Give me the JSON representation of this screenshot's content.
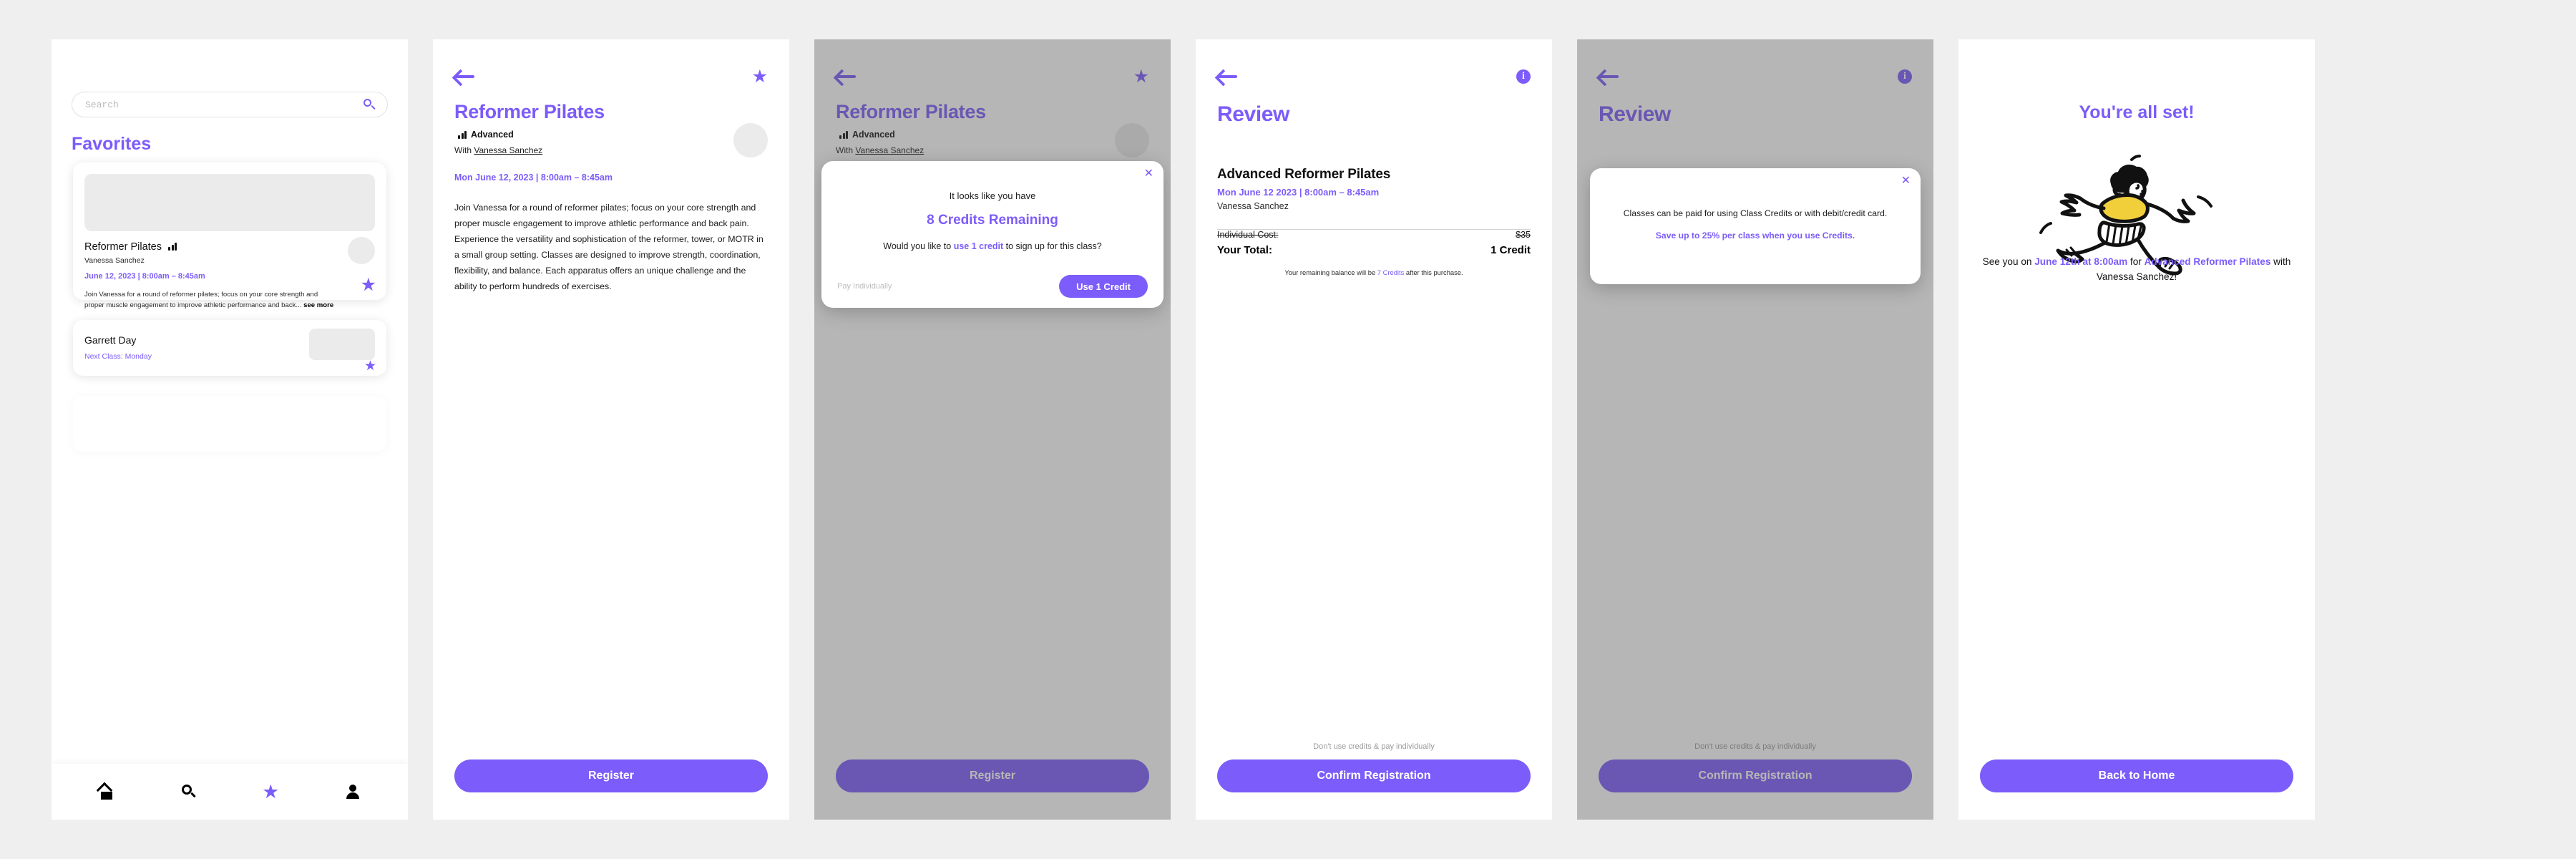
{
  "theme": {
    "accent": "#7c5cfa",
    "page_bg": "#efefef",
    "screen_bg": "#ffffff",
    "placeholder_gray": "#ebebeb"
  },
  "screens": [
    {
      "name": "favorites",
      "search": {
        "value": "",
        "placeholder": "Search",
        "icon": "search-icon"
      },
      "heading": "Favorites",
      "cards": [
        {
          "title": "Reformer Pilates",
          "level_icon": "difficulty-bars-icon",
          "instructor": "Vanessa Sanchez",
          "when": "June 12, 2023 | 8:00am – 8:45am",
          "description": "Join Vanessa for a round of reformer pilates; focus on your core strength and proper muscle engagement to improve athletic performance and back...",
          "see_more": "see more",
          "favorited": true
        },
        {
          "title": "Garrett Day",
          "next_class": "Next Class: Monday",
          "favorited": true
        }
      ],
      "tabs": [
        {
          "name": "home",
          "icon": "home-icon",
          "active": false
        },
        {
          "name": "search",
          "icon": "search-icon",
          "active": false
        },
        {
          "name": "favorites",
          "icon": "star-icon",
          "active": true
        },
        {
          "name": "profile",
          "icon": "person-icon",
          "active": false
        }
      ]
    },
    {
      "name": "class-detail",
      "back_icon": "back-arrow-icon",
      "favorite_icon": "star-icon",
      "title": "Reformer Pilates",
      "level": "Advanced",
      "level_icon": "difficulty-bars-icon",
      "with_prefix": "With ",
      "instructor": "Vanessa Sanchez",
      "when": "Mon June 12, 2023 | 8:00am – 8:45am",
      "body": "Join Vanessa for a round of reformer pilates; focus on your core strength and proper muscle engagement to improve athletic performance and back pain. Experience the versatility and sophistication of the reformer, tower, or MOTR in a small group setting. Classes are designed to improve strength, coordination, flexibility, and balance. Each apparatus offers an unique challenge and the ability to perform hundreds of exercises.",
      "cta": "Register"
    },
    {
      "name": "class-detail-credits-modal",
      "dimmed": true,
      "modal": {
        "close_icon": "close-icon",
        "line1": "It looks like you have",
        "headline": "8 Credits Remaining",
        "question_pre": "Would you like to ",
        "question_link": "use 1 credit",
        "question_post": " to sign up for this class?",
        "secondary_action": "Pay Individually",
        "primary_action": "Use 1 Credit"
      },
      "cta": "Register"
    },
    {
      "name": "review",
      "back_icon": "back-arrow-icon",
      "info_icon": "info-icon",
      "title": "Review",
      "class_title": "Advanced Reformer Pilates",
      "when": "Mon June 12 2023 | 8:00am – 8:45am",
      "instructor": "Vanessa Sanchez",
      "cost_label": "Individual Cost:",
      "cost_value": "$35",
      "total_label": "Your Total:",
      "total_value": "1 Credit",
      "balance_pre": "Your remaining balance will be ",
      "balance_value": "7 Credits",
      "balance_post": " after this purchase.",
      "sub_link": "Don't use credits & pay individually",
      "cta": "Confirm Registration"
    },
    {
      "name": "review-info-modal",
      "dimmed": true,
      "title": "Review",
      "modal": {
        "close_icon": "close-icon",
        "line1": "Classes can be paid for using Class Credits or with debit/credit card.",
        "line2": "Save up to 25% per class when you use Credits."
      },
      "sub_link": "Don't use credits & pay individually",
      "cta": "Confirm Registration"
    },
    {
      "name": "confirmation",
      "title": "You're all set!",
      "illustration": "running-person-illustration",
      "msg_pre": "See you on ",
      "msg_date": "June 12th at 8:00am",
      "msg_mid": " for ",
      "msg_class": "Advanced Reformer Pilates",
      "msg_post": " with Vanessa Sanchez!",
      "cta": "Back to Home"
    }
  ]
}
